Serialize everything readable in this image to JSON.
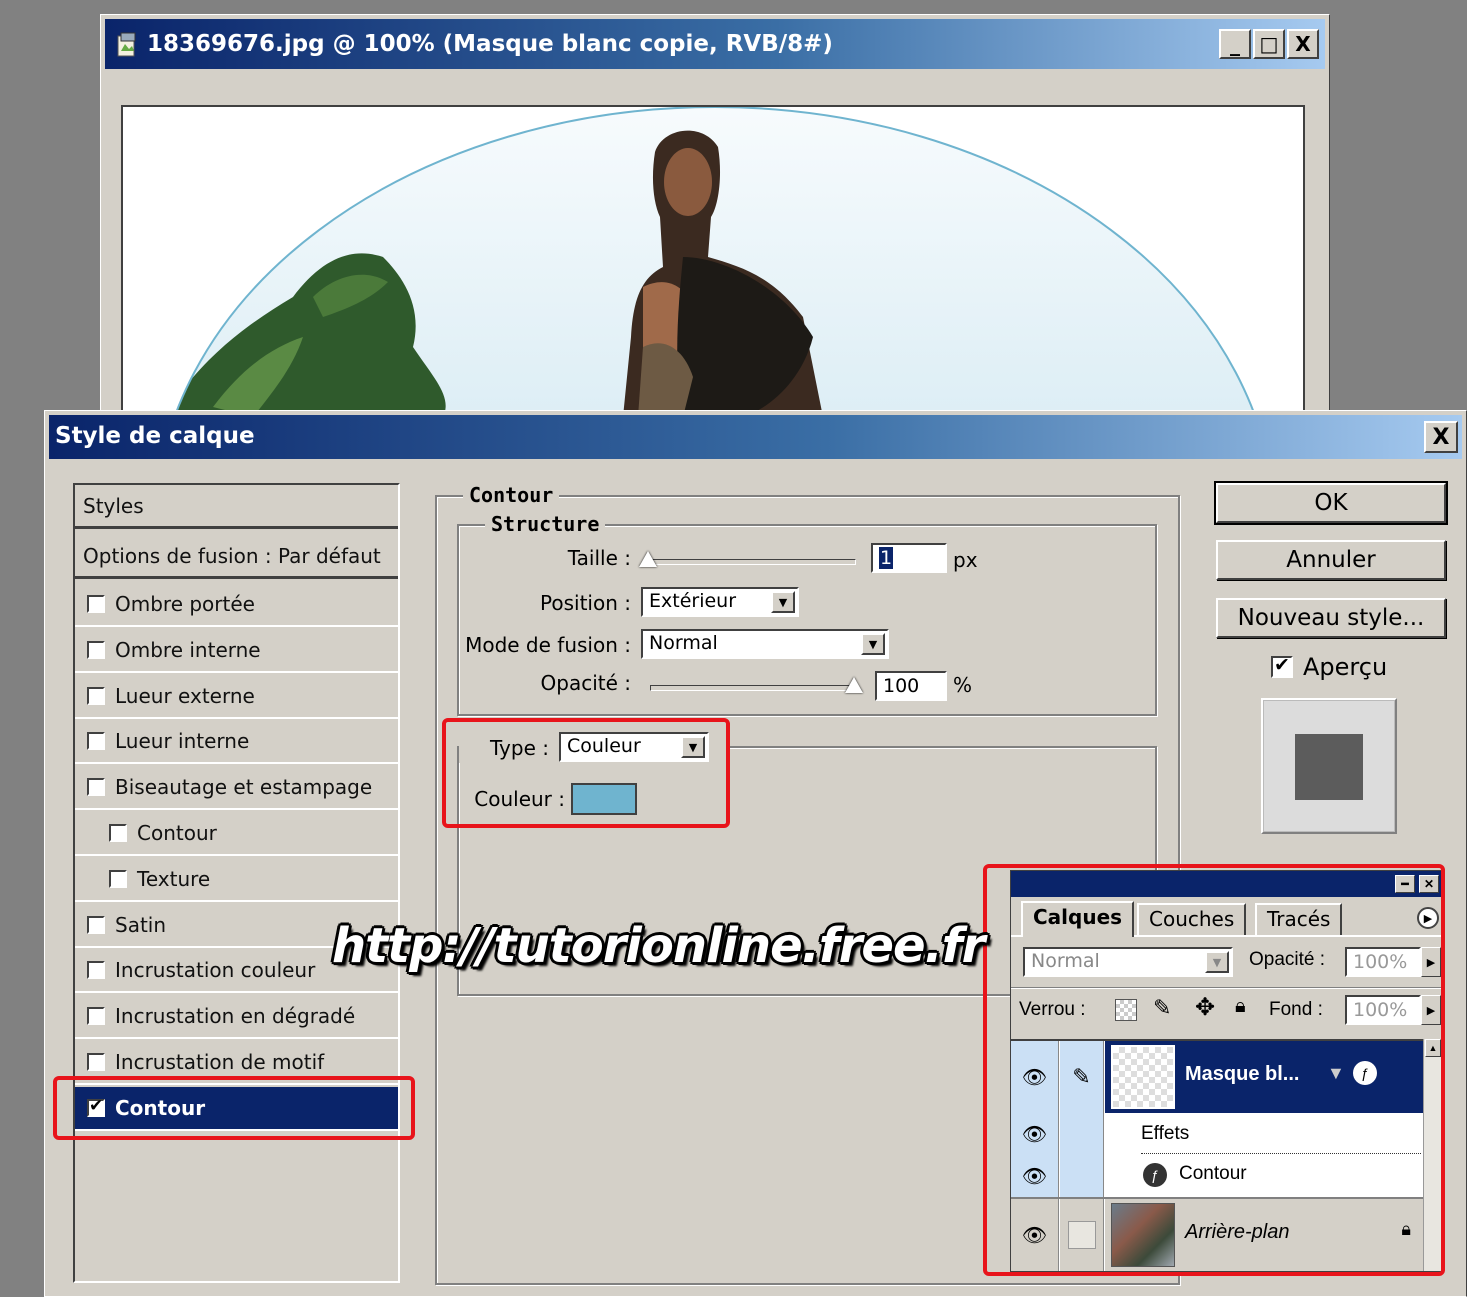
{
  "doc_window": {
    "title": "18369676.jpg @ 100% (Masque blanc copie, RVB/8#)",
    "buttons": [
      "_",
      "□",
      "X"
    ]
  },
  "dialog": {
    "title": "Style de calque",
    "close": "X",
    "styles_header": "Styles",
    "blend_options": "Options de fusion : Par défaut",
    "style_items": [
      {
        "label": "Ombre portée",
        "checked": false,
        "indent": false,
        "selected": false
      },
      {
        "label": "Ombre interne",
        "checked": false,
        "indent": false,
        "selected": false
      },
      {
        "label": "Lueur externe",
        "checked": false,
        "indent": false,
        "selected": false
      },
      {
        "label": "Lueur interne",
        "checked": false,
        "indent": false,
        "selected": false
      },
      {
        "label": "Biseautage et estampage",
        "checked": false,
        "indent": false,
        "selected": false
      },
      {
        "label": "Contour",
        "checked": false,
        "indent": true,
        "selected": false
      },
      {
        "label": "Texture",
        "checked": false,
        "indent": true,
        "selected": false
      },
      {
        "label": "Satin",
        "checked": false,
        "indent": false,
        "selected": false
      },
      {
        "label": "Incrustation couleur",
        "checked": false,
        "indent": false,
        "selected": false
      },
      {
        "label": "Incrustation en dégradé",
        "checked": false,
        "indent": false,
        "selected": false
      },
      {
        "label": "Incrustation de motif",
        "checked": false,
        "indent": false,
        "selected": false
      },
      {
        "label": "Contour",
        "checked": true,
        "indent": false,
        "selected": true
      }
    ],
    "section_title": "Contour",
    "structure_title": "Structure",
    "taille_label": "Taille :",
    "taille_value": "1",
    "taille_unit": "px",
    "position_label": "Position :",
    "position_value": "Extérieur",
    "mode_label": "Mode de fusion :",
    "mode_value": "Normal",
    "opacite_label": "Opacité :",
    "opacite_value": "100",
    "opacite_unit": "%",
    "type_label": "Type :",
    "type_value": "Couleur",
    "couleur_label": "Couleur :",
    "stroke_color": "#6fb4cf",
    "ok": "OK",
    "annuler": "Annuler",
    "nouveau_style": "Nouveau style...",
    "apercu_label": "Aperçu",
    "apercu_checked": true
  },
  "watermark": "http://tutorionline.free.fr",
  "layers_palette": {
    "tabs": [
      "Calques",
      "Couches",
      "Tracés"
    ],
    "blend_mode": "Normal",
    "opacite_label": "Opacité :",
    "opacite_value": "100%",
    "verrou_label": "Verrou :",
    "fond_label": "Fond :",
    "fond_value": "100%",
    "layers": {
      "layer1_name": "Masque bl...",
      "effects_label": "Effets",
      "effect_contour": "Contour",
      "background_name": "Arrière-plan"
    }
  },
  "colors": {
    "title_bar": "#0a246a",
    "selection": "#0a246a",
    "highlight_box": "#e8141b",
    "dialog_bg": "#d4d0c8"
  }
}
